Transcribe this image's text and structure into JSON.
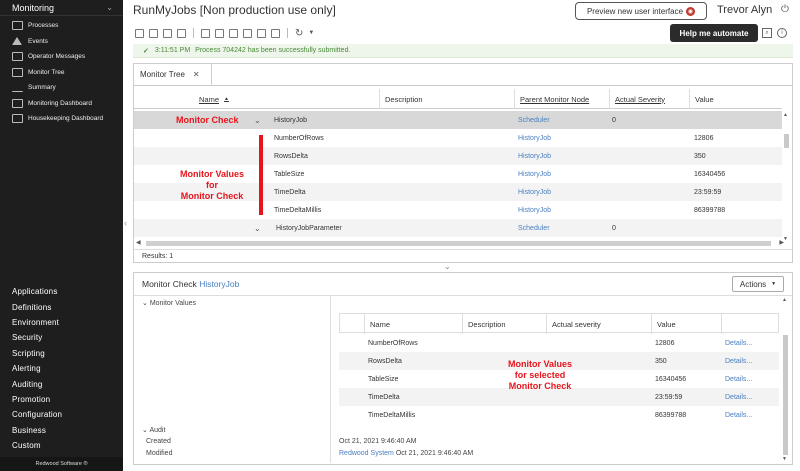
{
  "sidebar": {
    "header": "Monitoring",
    "items": [
      {
        "label": "Processes",
        "icon": "processes-icon"
      },
      {
        "label": "Events",
        "icon": "events-icon"
      },
      {
        "label": "Operator Messages",
        "icon": "messages-icon"
      },
      {
        "label": "Monitor Tree",
        "icon": "monitor-tree-icon"
      },
      {
        "label": "Summary",
        "icon": "summary-icon"
      },
      {
        "label": "Monitoring Dashboard",
        "icon": "dashboard-icon"
      },
      {
        "label": "Housekeeping Dashboard",
        "icon": "housekeeping-icon"
      }
    ],
    "categories": [
      "Applications",
      "Definitions",
      "Environment",
      "Security",
      "Scripting",
      "Alerting",
      "Auditing",
      "Promotion",
      "Configuration",
      "Business",
      "Custom"
    ],
    "footer": "Redwood Software ®"
  },
  "header": {
    "title": "RunMyJobs [Non production use only]",
    "preview_button": "Preview new user interface",
    "user": "Trevor Alyn",
    "help_button": "Help me automate"
  },
  "notification": {
    "time": "3:11:51 PM",
    "message": "Process 704242 has been successfully submitted."
  },
  "tree_panel": {
    "tab_label": "Monitor Tree",
    "columns": {
      "name": "Name",
      "sort_indicator": "▲",
      "description": "Description",
      "parent": "Parent Monitor Node",
      "severity": "Actual Severity",
      "value": "Value"
    },
    "rows": [
      {
        "name": "HistoryJob",
        "parent": "Scheduler",
        "severity": "0",
        "value": "",
        "expander": "⌄"
      },
      {
        "name": "NumberOfRows",
        "parent": "HistoryJob",
        "severity": "",
        "value": "12806",
        "expander": ""
      },
      {
        "name": "RowsDelta",
        "parent": "HistoryJob",
        "severity": "",
        "value": "350",
        "expander": ""
      },
      {
        "name": "TableSize",
        "parent": "HistoryJob",
        "severity": "",
        "value": "16340456",
        "expander": ""
      },
      {
        "name": "TimeDelta",
        "parent": "HistoryJob",
        "severity": "",
        "value": "23:59:59",
        "expander": ""
      },
      {
        "name": "TimeDeltaMillis",
        "parent": "HistoryJob",
        "severity": "",
        "value": "86399788",
        "expander": ""
      },
      {
        "name": "HistoryJobParameter",
        "parent": "Scheduler",
        "severity": "0",
        "value": "",
        "expander": "⌄"
      }
    ],
    "results": "Results: 1"
  },
  "detail_panel": {
    "title_prefix": "Monitor Check",
    "title_link": "HistoryJob",
    "actions_button": "Actions",
    "section_monitor_values": "Monitor Values",
    "columns": {
      "name": "Name",
      "description": "Description",
      "severity": "Actual severity",
      "value": "Value"
    },
    "rows": [
      {
        "name": "NumberOfRows",
        "value": "12806",
        "link": "Details..."
      },
      {
        "name": "RowsDelta",
        "value": "350",
        "link": "Details..."
      },
      {
        "name": "TableSize",
        "value": "16340456",
        "link": "Details..."
      },
      {
        "name": "TimeDelta",
        "value": "23:59:59",
        "link": "Details..."
      },
      {
        "name": "TimeDeltaMillis",
        "value": "86399788",
        "link": "Details..."
      }
    ],
    "audit": {
      "section": "Audit",
      "created_label": "Created",
      "modified_label": "Modified",
      "created_value": "Oct 21, 2021 9:46:40 AM",
      "modified_user": "Redwood System",
      "modified_value": "Oct 21, 2021 9:46:40 AM"
    }
  },
  "annotations": {
    "monitor_check": "Monitor Check",
    "monitor_values_1": "Monitor Values",
    "monitor_values_2": "for",
    "monitor_values_3": "Monitor Check",
    "selected_1": "Monitor Values",
    "selected_2": "for selected",
    "selected_3": "Monitor Check"
  },
  "colors": {
    "annotation": "#e8141c",
    "link": "#4a7fc1",
    "sidebar_bg": "#1e1e1e",
    "success": "#4a8a3a"
  }
}
